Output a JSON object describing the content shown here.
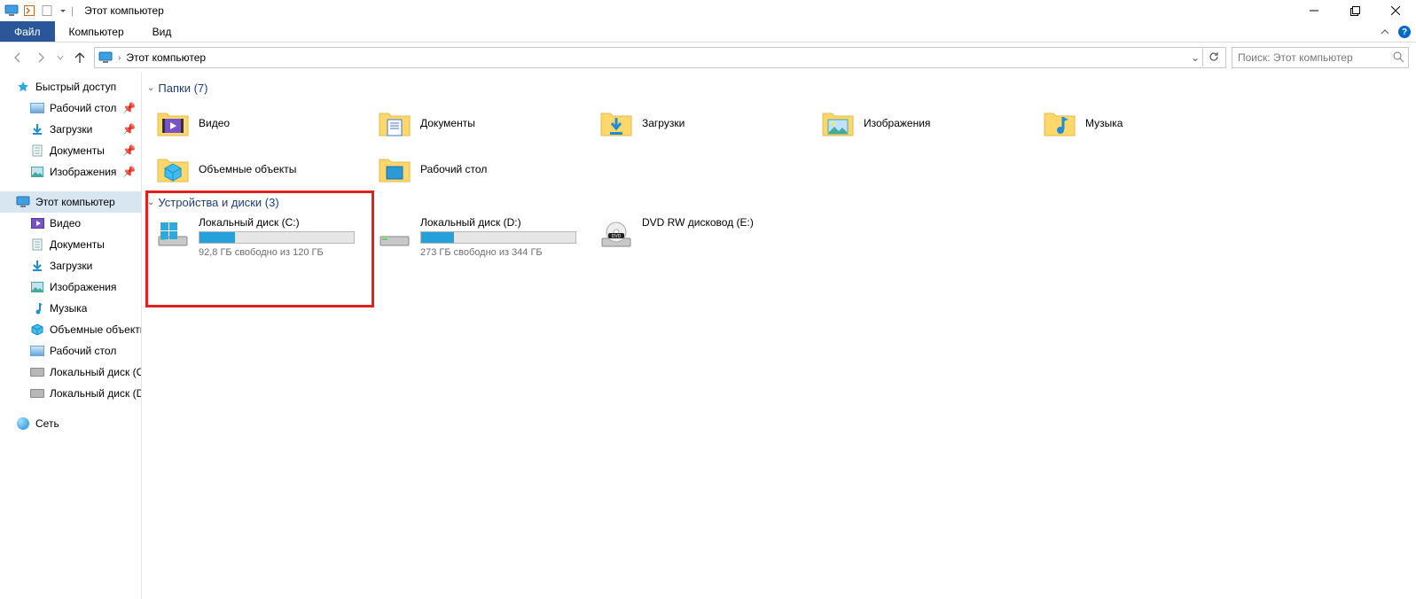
{
  "title": "Этот компьютер",
  "ribbon": {
    "file": "Файл",
    "tabs": [
      "Компьютер",
      "Вид"
    ]
  },
  "addressbar": {
    "location": "Этот компьютер"
  },
  "search": {
    "placeholder": "Поиск: Этот компьютер"
  },
  "sidebar": {
    "quick": {
      "label": "Быстрый доступ"
    },
    "desktop": {
      "label": "Рабочий стол"
    },
    "downloads": {
      "label": "Загрузки"
    },
    "documents": {
      "label": "Документы"
    },
    "pictures": {
      "label": "Изображения"
    },
    "this_pc": {
      "label": "Этот компьютер"
    },
    "video": {
      "label": "Видео"
    },
    "documents2": {
      "label": "Документы"
    },
    "downloads2": {
      "label": "Загрузки"
    },
    "pictures2": {
      "label": "Изображения"
    },
    "music": {
      "label": "Музыка"
    },
    "objects3d": {
      "label": "Объемные объекты"
    },
    "desktop2": {
      "label": "Рабочий стол"
    },
    "c_drive": {
      "label": "Локальный диск (C:)"
    },
    "d_drive": {
      "label": "Локальный диск (D:)"
    },
    "network": {
      "label": "Сеть"
    }
  },
  "groups": {
    "folders": {
      "title": "Папки (7)",
      "items": [
        {
          "label": "Видео"
        },
        {
          "label": "Документы"
        },
        {
          "label": "Загрузки"
        },
        {
          "label": "Изображения"
        },
        {
          "label": "Музыка"
        },
        {
          "label": "Объемные объекты"
        },
        {
          "label": "Рабочий стол"
        }
      ]
    },
    "drives": {
      "title": "Устройства и диски (3)",
      "items": [
        {
          "label": "Локальный диск (C:)",
          "free_text": "92,8 ГБ свободно из 120 ГБ",
          "fill_pct": 23
        },
        {
          "label": "Локальный диск (D:)",
          "free_text": "273 ГБ свободно из 344 ГБ",
          "fill_pct": 21
        },
        {
          "label": "DVD RW дисковод (E:)"
        }
      ]
    }
  }
}
